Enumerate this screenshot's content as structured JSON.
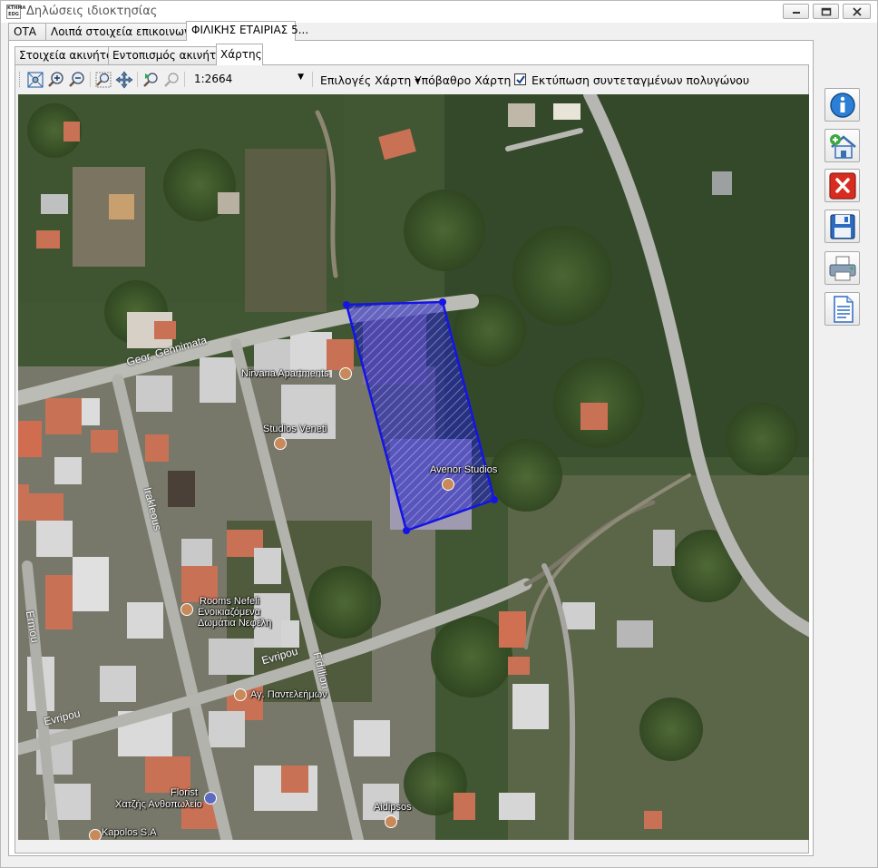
{
  "window": {
    "title": "Δηλώσεις ιδιοκτησίας",
    "app_icon_text": "KTHMA EDG"
  },
  "outer_tabs": [
    {
      "label": "ΟΤΑ"
    },
    {
      "label": "Λοιπά στοιχεία επικοινωνίας"
    },
    {
      "label": "ΦΙΛΙΚΗΣ ΕΤΑΙΡΙΑΣ 5..."
    }
  ],
  "inner_tabs": [
    {
      "label": "Στοιχεία ακινήτου"
    },
    {
      "label": "Εντοπισμός ακινήτου"
    },
    {
      "label": "Χάρτης"
    }
  ],
  "toolbar": {
    "scale_value": "1:2664",
    "map_options_label": "Επιλογές Χάρτη",
    "basemap_label": "Υπόβαθρο Χάρτη",
    "print_coords_label": "Εκτύπωση συντεταγμένων πολυγώνου",
    "print_coords_checked": true
  },
  "map": {
    "labels": {
      "nirvana": "Nirvana Apartments",
      "veneti": "Studios Veneti",
      "avenor": "Avenor Studios",
      "rooms_nefeli": "Rooms Nefeli",
      "rooms_nefeli_gr1": "Ενοικιαζόμενα",
      "rooms_nefeli_gr2": "Δωμάτια Νεφέλη",
      "ag_panteleimon": "Αγ. Παντελεήμων",
      "florist": "Florist",
      "florist_gr": "Χατζής Ανθοπωλείο",
      "aidipsos": "Aidipsos",
      "kapolos": "Kapolos S.A"
    },
    "roads": {
      "gennimata": "Geor. Gennimata",
      "irakleous": "Irakleous",
      "ermou": "Ermou",
      "evripou_1": "Evripou",
      "evripou_2": "Evripou",
      "fidillion": "Fidillion"
    }
  }
}
